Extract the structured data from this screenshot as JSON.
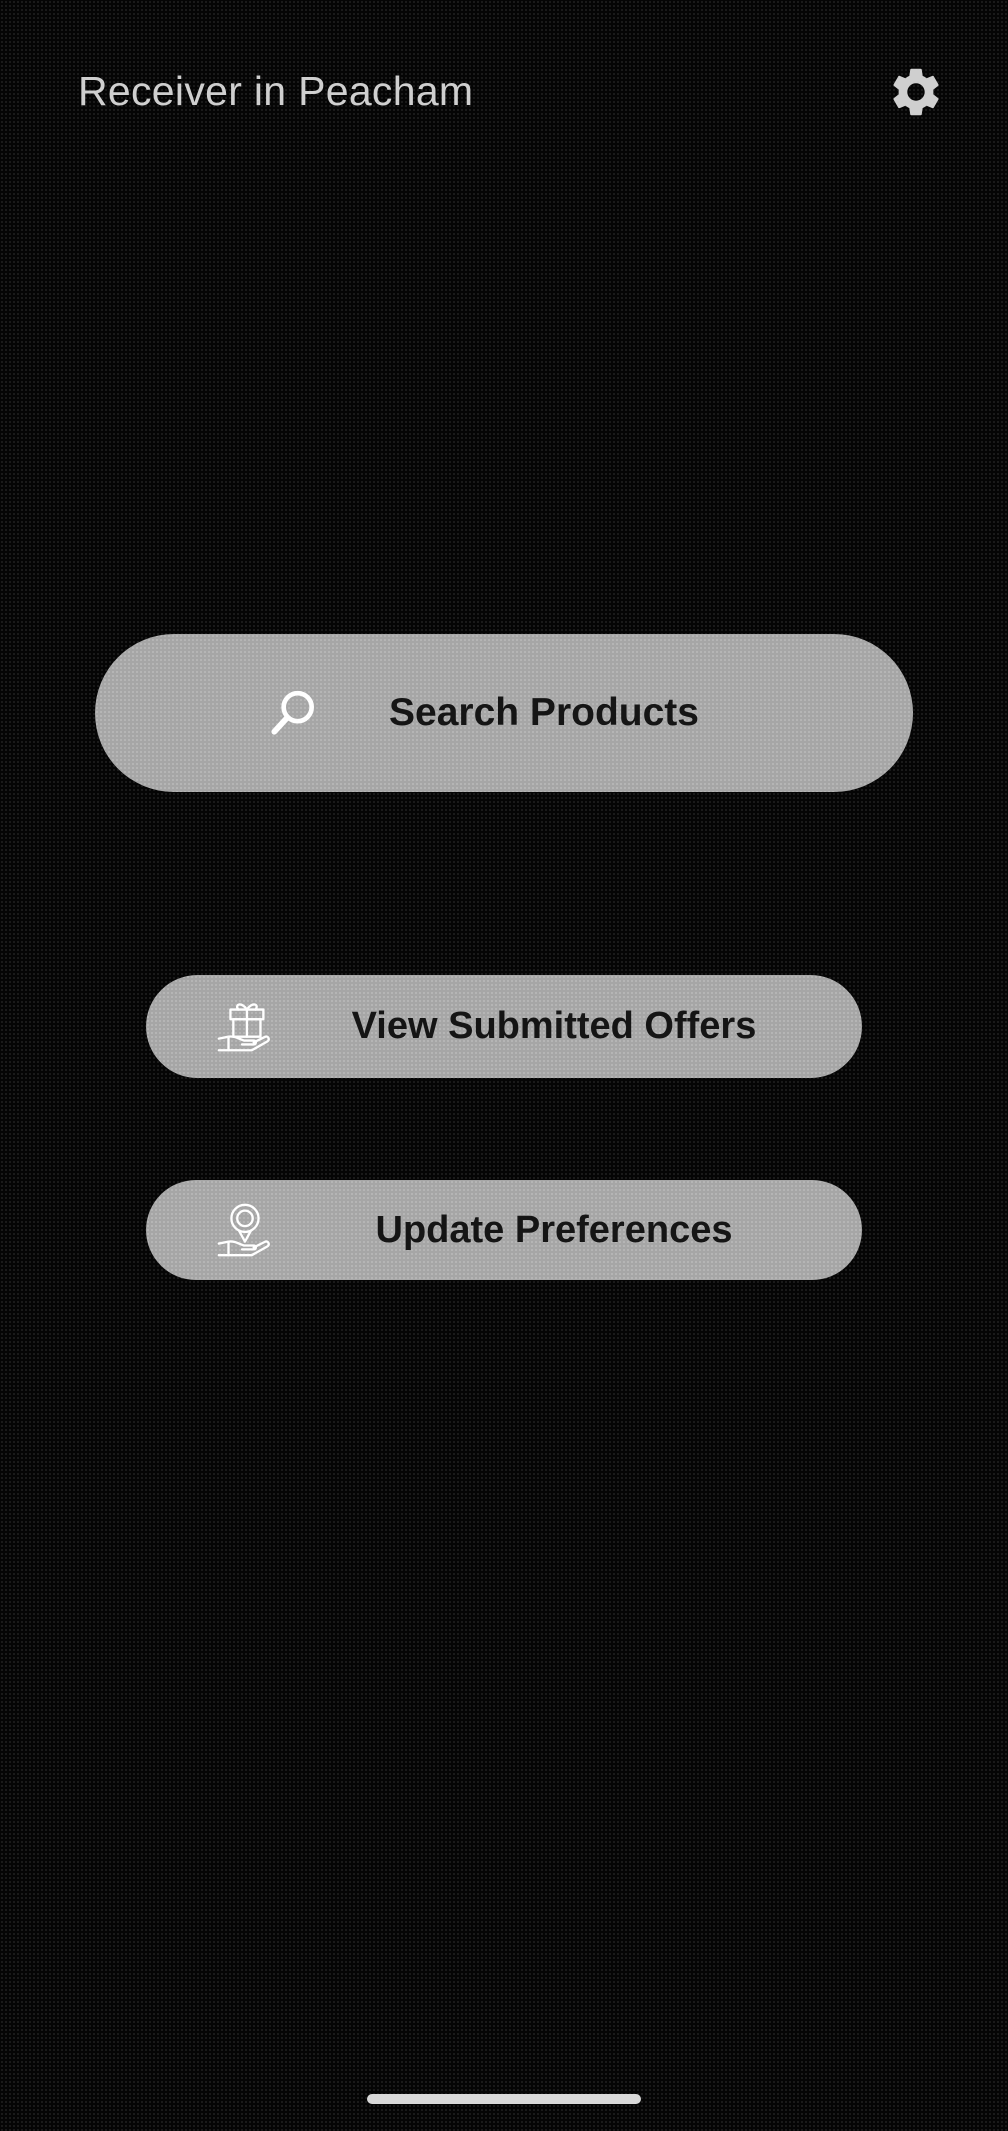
{
  "header": {
    "title": "Receiver in Peacham",
    "settings_icon": "gear-icon"
  },
  "actions": {
    "search": {
      "label": "Search Products",
      "icon": "search-icon"
    },
    "offers": {
      "label": "View Submitted Offers",
      "icon": "gift-hand-icon"
    },
    "preferences": {
      "label": "Update Preferences",
      "icon": "location-hand-icon"
    }
  },
  "colors": {
    "background": "#050505",
    "button": "#a6a6a6",
    "button_text": "#151515",
    "title_text": "#cfcfcf",
    "icon_stroke": "#ffffff"
  }
}
